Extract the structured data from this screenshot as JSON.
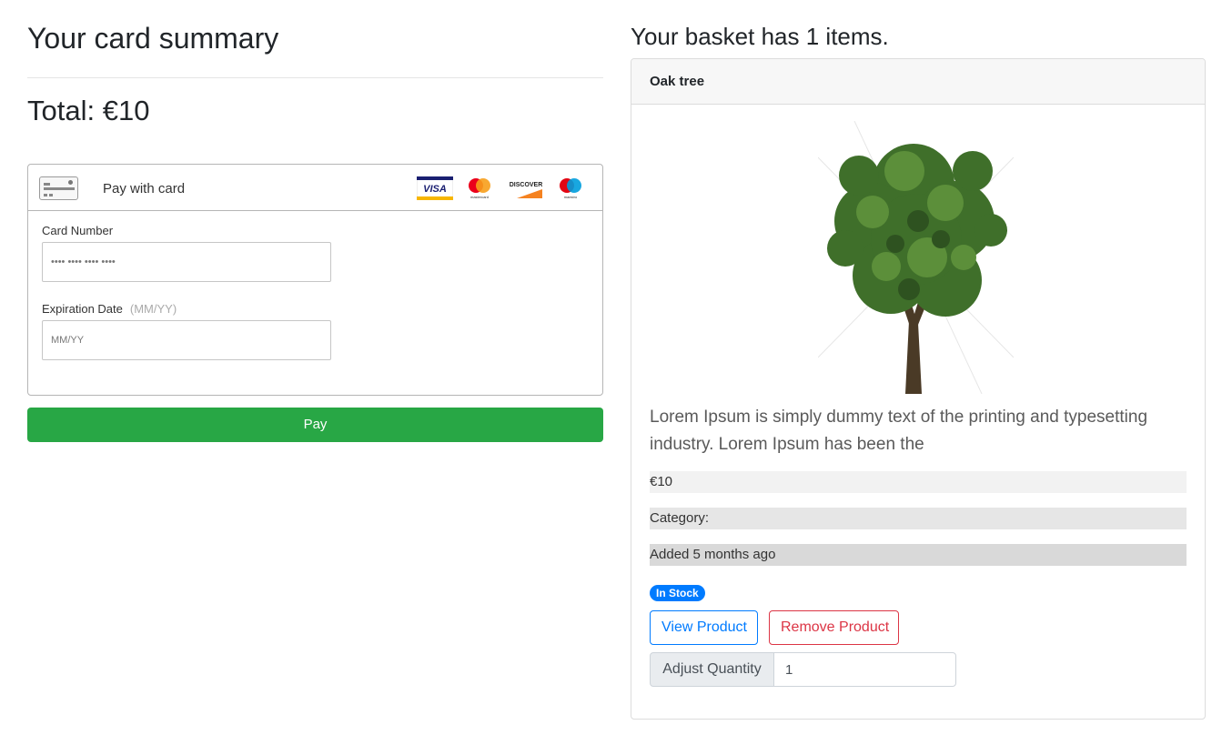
{
  "summary": {
    "title": "Your card summary",
    "total": "Total: €10"
  },
  "payment": {
    "header_label": "Pay with card",
    "brands": [
      "visa-logo",
      "mastercard-logo",
      "discover-logo",
      "maestro-logo"
    ],
    "visa_text": "VISA",
    "mastercard_text": "mastercard",
    "discover_text": "DISCOVER",
    "maestro_text": "maestro",
    "card_number_label": "Card Number",
    "card_number_value": "•••• •••• •••• ••••",
    "expiration_label": "Expiration Date",
    "expiration_hint": "(MM/YY)",
    "expiration_placeholder": "MM/YY",
    "pay_button": "Pay"
  },
  "basket": {
    "title": "Your basket has 1 items.",
    "item": {
      "name": "Oak tree",
      "image": "oak-tree-image",
      "description": "Lorem Ipsum is simply dummy text of the printing and typesetting industry. Lorem Ipsum has been the",
      "price": "€10",
      "category": "Category:",
      "added": "Added 5 months ago",
      "stock_badge": "In Stock",
      "view_button": "View Product",
      "remove_button": "Remove Product",
      "quantity_label": "Adjust Quantity",
      "quantity_value": "1"
    }
  },
  "colors": {
    "pay_green": "#28a745",
    "primary_blue": "#007bff",
    "danger_red": "#dc3545"
  }
}
